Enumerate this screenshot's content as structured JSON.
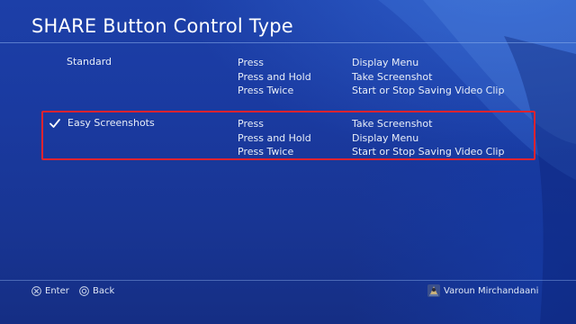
{
  "header": {
    "title": "SHARE Button Control Type"
  },
  "options": [
    {
      "name": "Standard",
      "selected": false,
      "mappings": [
        {
          "action": "Press",
          "result": "Display Menu"
        },
        {
          "action": "Press and Hold",
          "result": "Take Screenshot"
        },
        {
          "action": "Press Twice",
          "result": "Start or Stop Saving Video Clip"
        }
      ]
    },
    {
      "name": "Easy Screenshots",
      "selected": true,
      "mappings": [
        {
          "action": "Press",
          "result": "Take Screenshot"
        },
        {
          "action": "Press and Hold",
          "result": "Display Menu"
        },
        {
          "action": "Press Twice",
          "result": "Start or Stop Saving Video Clip"
        }
      ]
    }
  ],
  "footer": {
    "enter_label": "Enter",
    "back_label": "Back",
    "enter_icon": "cross-button-icon",
    "back_icon": "circle-button-icon",
    "user_name": "Varoun Mirchandaani",
    "user_icon": "avatar-icon"
  },
  "colors": {
    "background": "#1a3aa0",
    "focus_border": "#e0232f",
    "text": "#e8eef8"
  }
}
